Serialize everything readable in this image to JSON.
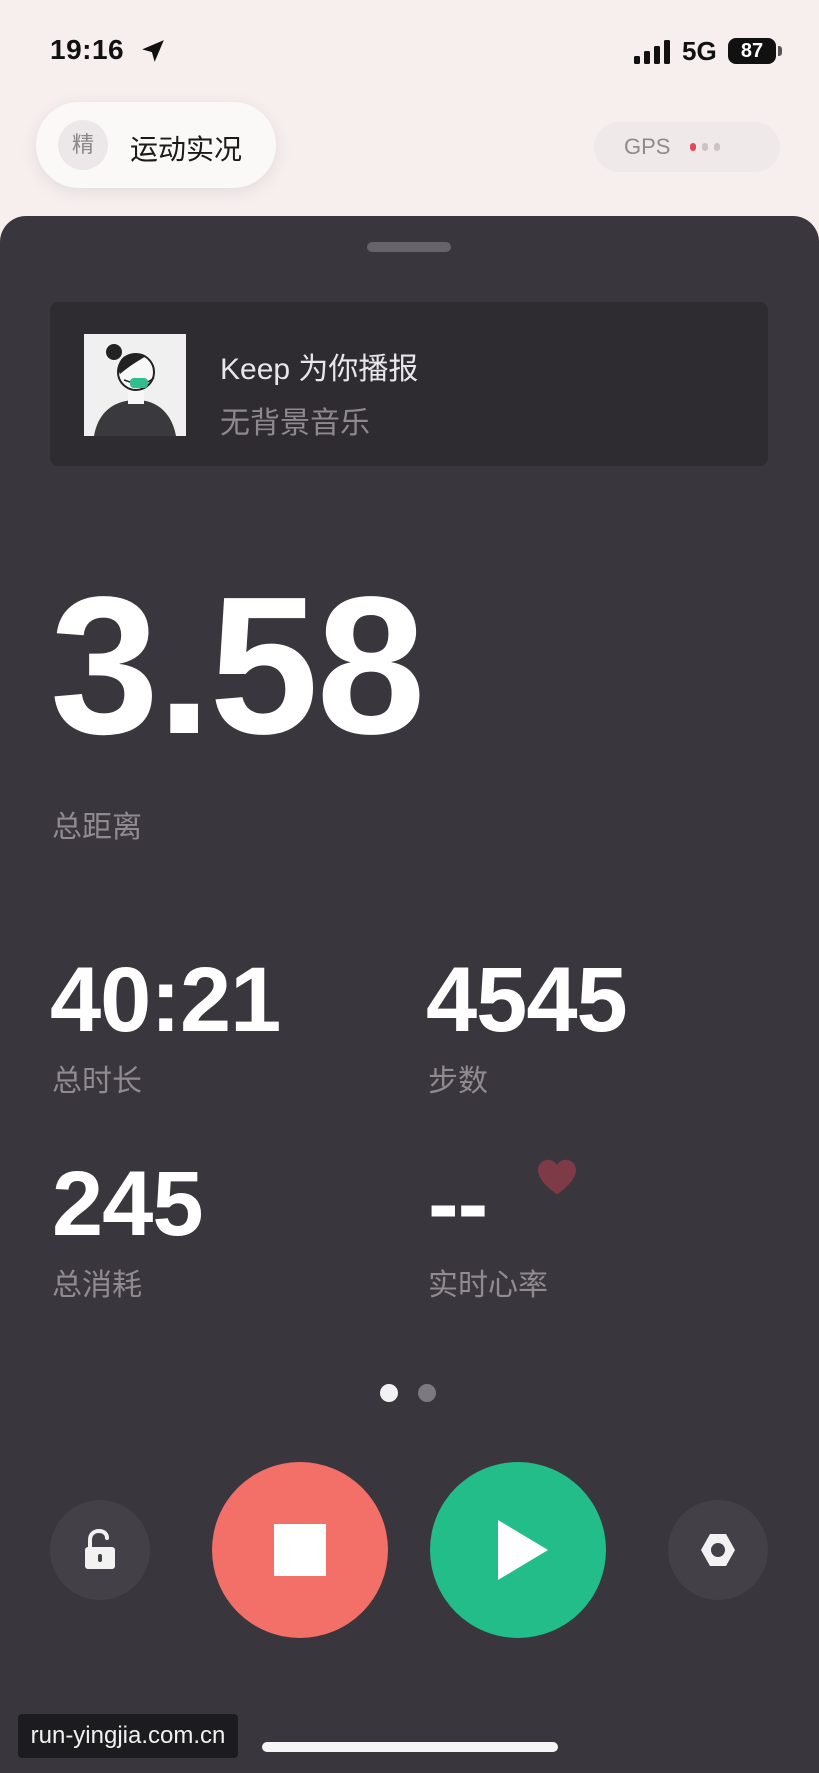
{
  "status_bar": {
    "time": "19:16",
    "network": "5G",
    "battery": "87"
  },
  "header": {
    "mode_badge": "精",
    "title": "运动实况",
    "gps_label": "GPS"
  },
  "voice": {
    "title": "Keep 为你播报",
    "subtitle": "无背景音乐"
  },
  "stats": {
    "distance": {
      "value": "3.58",
      "label": "总距离"
    },
    "duration": {
      "value": "40:21",
      "label": "总时长"
    },
    "steps": {
      "value": "4545",
      "label": "步数"
    },
    "calories": {
      "value": "245",
      "label": "总消耗"
    },
    "heart_rate": {
      "value": "--",
      "label": "实时心率"
    }
  },
  "pager": {
    "count": 2,
    "active": 0
  },
  "colors": {
    "panel": "#39363d",
    "stop": "#f37068",
    "play": "#22bd88",
    "heart": "#7e3a47",
    "gps_red": "#e04a5a"
  },
  "icons": [
    "location-arrow-icon",
    "signal-icon",
    "heart-icon",
    "unlock-icon",
    "stop-icon",
    "play-icon",
    "settings-icon"
  ],
  "watermark": "run-yingjia.com.cn"
}
